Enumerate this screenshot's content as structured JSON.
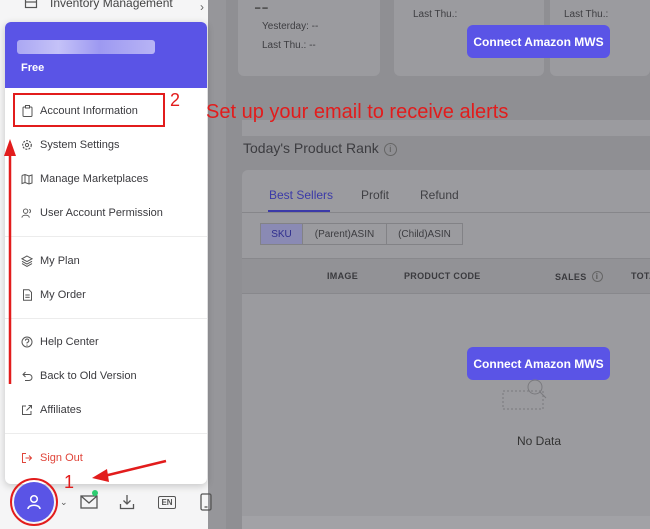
{
  "top_nav": {
    "label": "Inventory Management"
  },
  "stats": {
    "big_value": "--",
    "yesterday": "Yesterday: --",
    "last_thu_1": "Last Thu.: --",
    "last_thu_2": "Last Thu.:",
    "last_thu_3": "Last Thu.:"
  },
  "connect_button_label": "Connect Amazon MWS",
  "rank": {
    "title": "Today's Product Rank",
    "tabs": [
      "Best Sellers",
      "Profit",
      "Refund"
    ],
    "segments": [
      "SKU",
      "(Parent)ASIN",
      "(Child)ASIN"
    ],
    "columns": [
      "IMAGE",
      "PRODUCT CODE",
      "SALES",
      "TOTA"
    ],
    "empty_text": "No Data"
  },
  "menu": {
    "plan": "Free",
    "items": [
      {
        "label": "Account Information",
        "icon": "clipboard-icon"
      },
      {
        "label": "System Settings",
        "icon": "gear-icon"
      },
      {
        "label": "Manage Marketplaces",
        "icon": "map-icon"
      },
      {
        "label": "User Account Permission",
        "icon": "users-icon"
      },
      {
        "label": "My Plan",
        "icon": "layers-icon"
      },
      {
        "label": "My Order",
        "icon": "document-icon"
      },
      {
        "label": "Help Center",
        "icon": "help-icon"
      },
      {
        "label": "Back to Old Version",
        "icon": "undo-icon"
      },
      {
        "label": "Affiliates",
        "icon": "external-link-icon"
      },
      {
        "label": "Sign Out",
        "icon": "sign-out-icon"
      }
    ]
  },
  "toolbar": {
    "language": "EN"
  },
  "annotations": {
    "note": "Set up your email to receive alerts",
    "step1": "1",
    "step2": "2"
  },
  "colors": {
    "accent": "#5a54e6",
    "annotation_red": "#e21c1c",
    "signout_red": "#e0453a"
  }
}
